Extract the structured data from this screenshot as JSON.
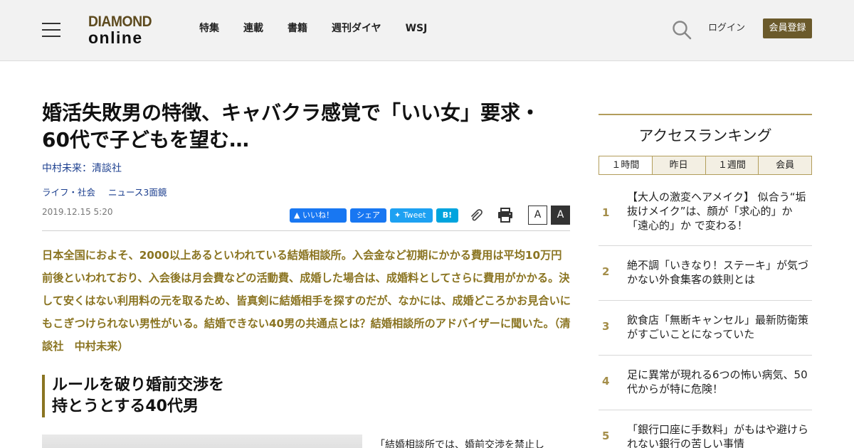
{
  "header": {
    "logo_top": "DIAMOND",
    "logo_bottom": "online",
    "nav": [
      "特集",
      "連載",
      "書籍",
      "週刊ダイヤ",
      "WSJ"
    ],
    "login": "ログイン",
    "register": "会員登録"
  },
  "article": {
    "title": "婚活失敗男の特徴、キャバクラ感覚で「いい女」要求・60代で子どもを望む…",
    "author": "中村未来：清談社",
    "categories": [
      "ライフ・社会",
      "ニュース3面鏡"
    ],
    "date": "2019.12.15 5:20",
    "share": {
      "fb_like": "いいね！",
      "fb_share": "シェア",
      "tweet": "Tweet",
      "hatena": "B!"
    },
    "font_small": "A",
    "font_large": "A",
    "lead": "日本全国におよそ、2000以上あるといわれている結婚相談所。入会金など初期にかかる費用は平均10万円前後といわれており、入会後は月会費などの活動費、成婚した場合は、成婚料としてさらに費用がかかる。決して安くはない利用料の元を取るため、皆真剣に結婚相手を探すのだが、なかには、成婚どころかお見合いにもこぎつけられない男性がいる。結婚できない40男の共通点とは？結婚相談所のアドバイザーに聞いた。（清談社　中村未来）",
    "heading_line1": "ルールを破り婚前交渉を",
    "heading_line2": "持とうとする40代男",
    "body_start": "「結婚相談所では、婚前交渉を禁止し"
  },
  "sidebar": {
    "title": "アクセスランキング",
    "tabs": [
      "１時間",
      "昨日",
      "１週間",
      "会員"
    ],
    "ranking": [
      {
        "rank": "1",
        "text": "【大人の激変ヘアメイク】 似合う“垢抜けメイク”は、顔が「求心的」か「遠心的」か で変わる！"
      },
      {
        "rank": "2",
        "text": "絶不調「いきなり！ステーキ」が気づかない外食集客の鉄則とは"
      },
      {
        "rank": "3",
        "text": "飲食店「無断キャンセル」最新防衛策がすごいことになっていた"
      },
      {
        "rank": "4",
        "text": "足に異常が現れる6つの怖い病気、50代からが特に危険！"
      },
      {
        "rank": "5",
        "text": "「銀行口座に手数料」がもはや避けられない銀行の苦しい事情"
      }
    ]
  },
  "colors": {
    "accent": "#8a7421",
    "link": "#1c3f8f",
    "register_bg": "#6b5a2b"
  }
}
